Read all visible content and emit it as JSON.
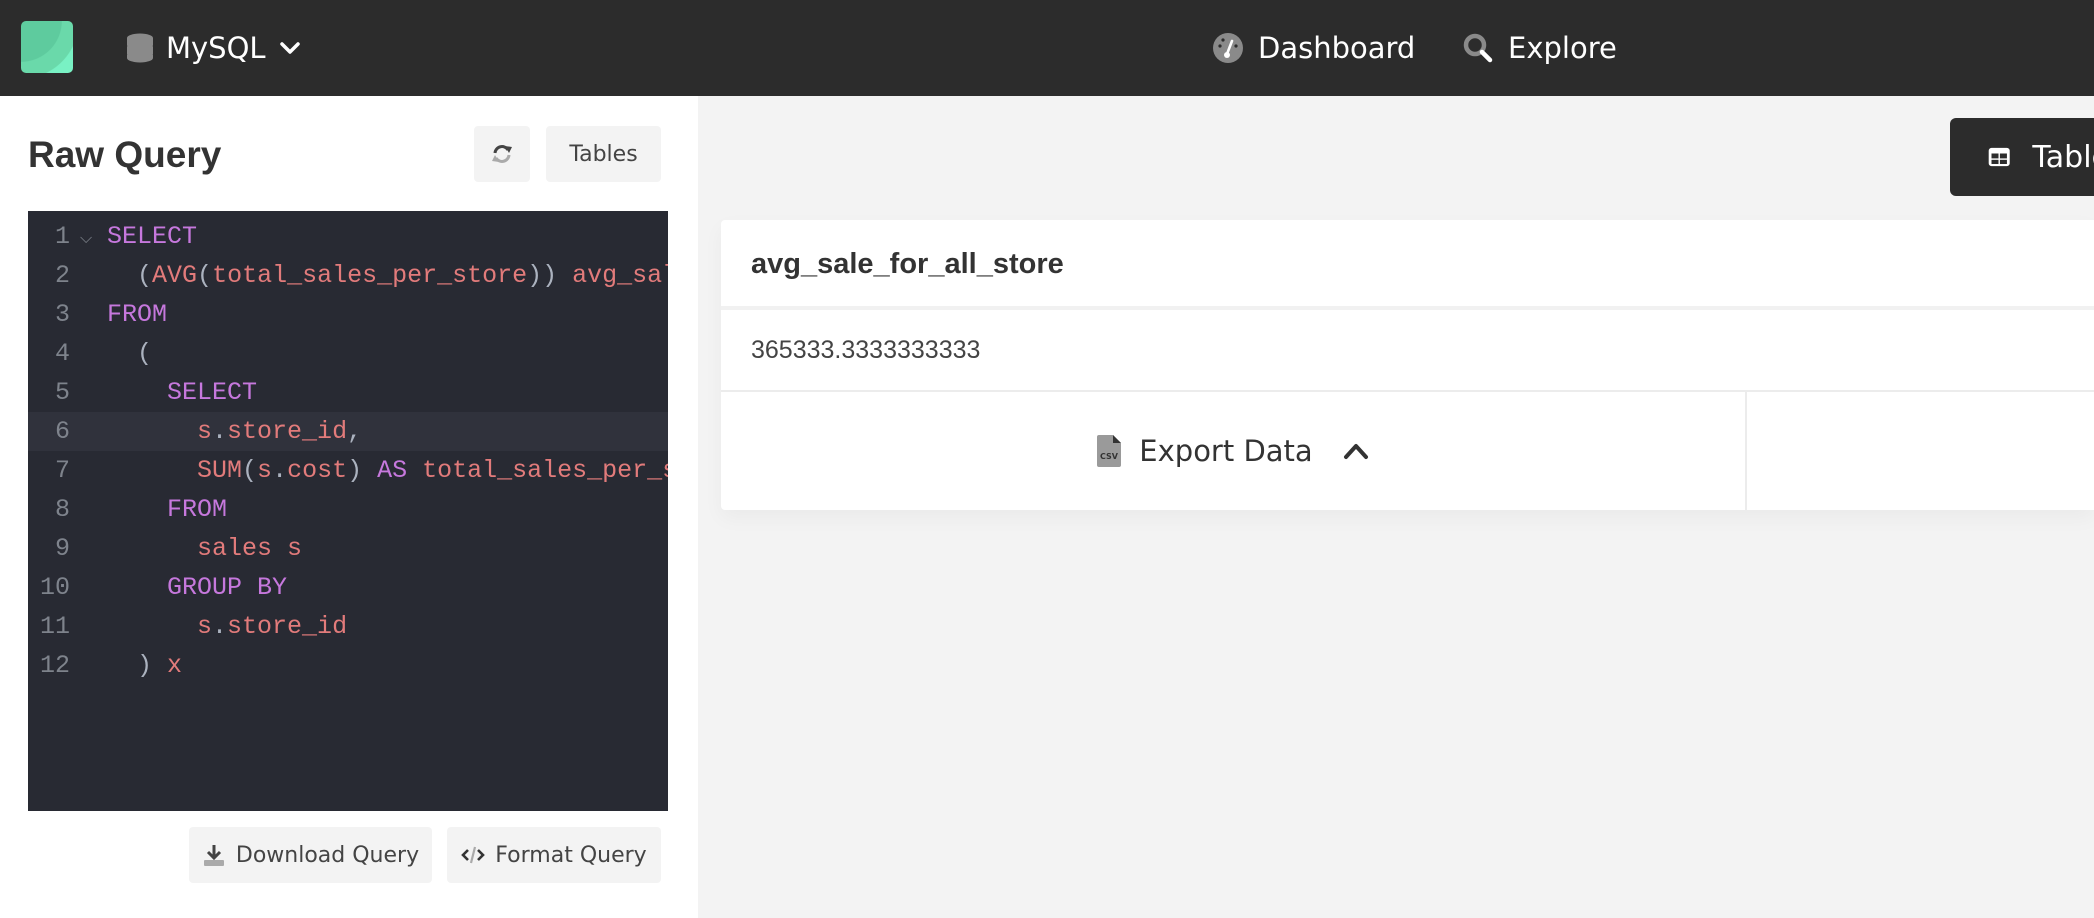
{
  "topbar": {
    "db_label": "MySQL",
    "nav": [
      {
        "label": "Dashboard",
        "icon": "dashboard-gauge-icon"
      },
      {
        "label": "Explore",
        "icon": "search-icon"
      }
    ]
  },
  "left_panel": {
    "title": "Raw Query",
    "refresh_icon": "refresh-icon",
    "tables_label": "Tables",
    "download_label": "Download Query",
    "format_label": "Format Query"
  },
  "editor": {
    "active_line": 6,
    "lines": [
      {
        "n": "1",
        "indent": "",
        "tokens": [
          [
            "kw",
            "SELECT"
          ]
        ]
      },
      {
        "n": "2",
        "indent": "  ",
        "tokens": [
          [
            "pn",
            "("
          ],
          [
            "tx",
            "AVG"
          ],
          [
            "pn",
            "("
          ],
          [
            "tx",
            "total_sales_per_store"
          ],
          [
            "pn",
            "))"
          ],
          [
            "tx",
            " avg_sale_for_all_store"
          ]
        ]
      },
      {
        "n": "3",
        "indent": "",
        "tokens": [
          [
            "kw",
            "FROM"
          ]
        ]
      },
      {
        "n": "4",
        "indent": "  ",
        "tokens": [
          [
            "pn",
            "("
          ]
        ]
      },
      {
        "n": "5",
        "indent": "    ",
        "tokens": [
          [
            "kw",
            "SELECT"
          ]
        ]
      },
      {
        "n": "6",
        "indent": "      ",
        "tokens": [
          [
            "tx",
            "s"
          ],
          [
            "pn",
            "."
          ],
          [
            "tx",
            "store_id"
          ],
          [
            "pn",
            ","
          ]
        ]
      },
      {
        "n": "7",
        "indent": "      ",
        "tokens": [
          [
            "tx",
            "SUM"
          ],
          [
            "pn",
            "("
          ],
          [
            "tx",
            "s"
          ],
          [
            "pn",
            "."
          ],
          [
            "tx",
            "cost"
          ],
          [
            "pn",
            ")"
          ],
          [
            "kw",
            " AS"
          ],
          [
            "tx",
            " total_sales_per_store"
          ]
        ]
      },
      {
        "n": "8",
        "indent": "    ",
        "tokens": [
          [
            "kw",
            "FROM"
          ]
        ]
      },
      {
        "n": "9",
        "indent": "      ",
        "tokens": [
          [
            "tx",
            "sales s"
          ]
        ]
      },
      {
        "n": "10",
        "indent": "    ",
        "tokens": [
          [
            "kw",
            "GROUP BY"
          ]
        ]
      },
      {
        "n": "11",
        "indent": "      ",
        "tokens": [
          [
            "tx",
            "s"
          ],
          [
            "pn",
            "."
          ],
          [
            "tx",
            "store_id"
          ]
        ]
      },
      {
        "n": "12",
        "indent": "  ",
        "tokens": [
          [
            "pn",
            ")"
          ],
          [
            "tx",
            " x"
          ]
        ]
      }
    ]
  },
  "right_panel": {
    "view_tab_label": "Table",
    "result": {
      "columns": [
        "avg_sale_for_all_store"
      ],
      "rows": [
        [
          "365333.3333333333"
        ]
      ]
    },
    "export_label": "Export Data"
  }
}
